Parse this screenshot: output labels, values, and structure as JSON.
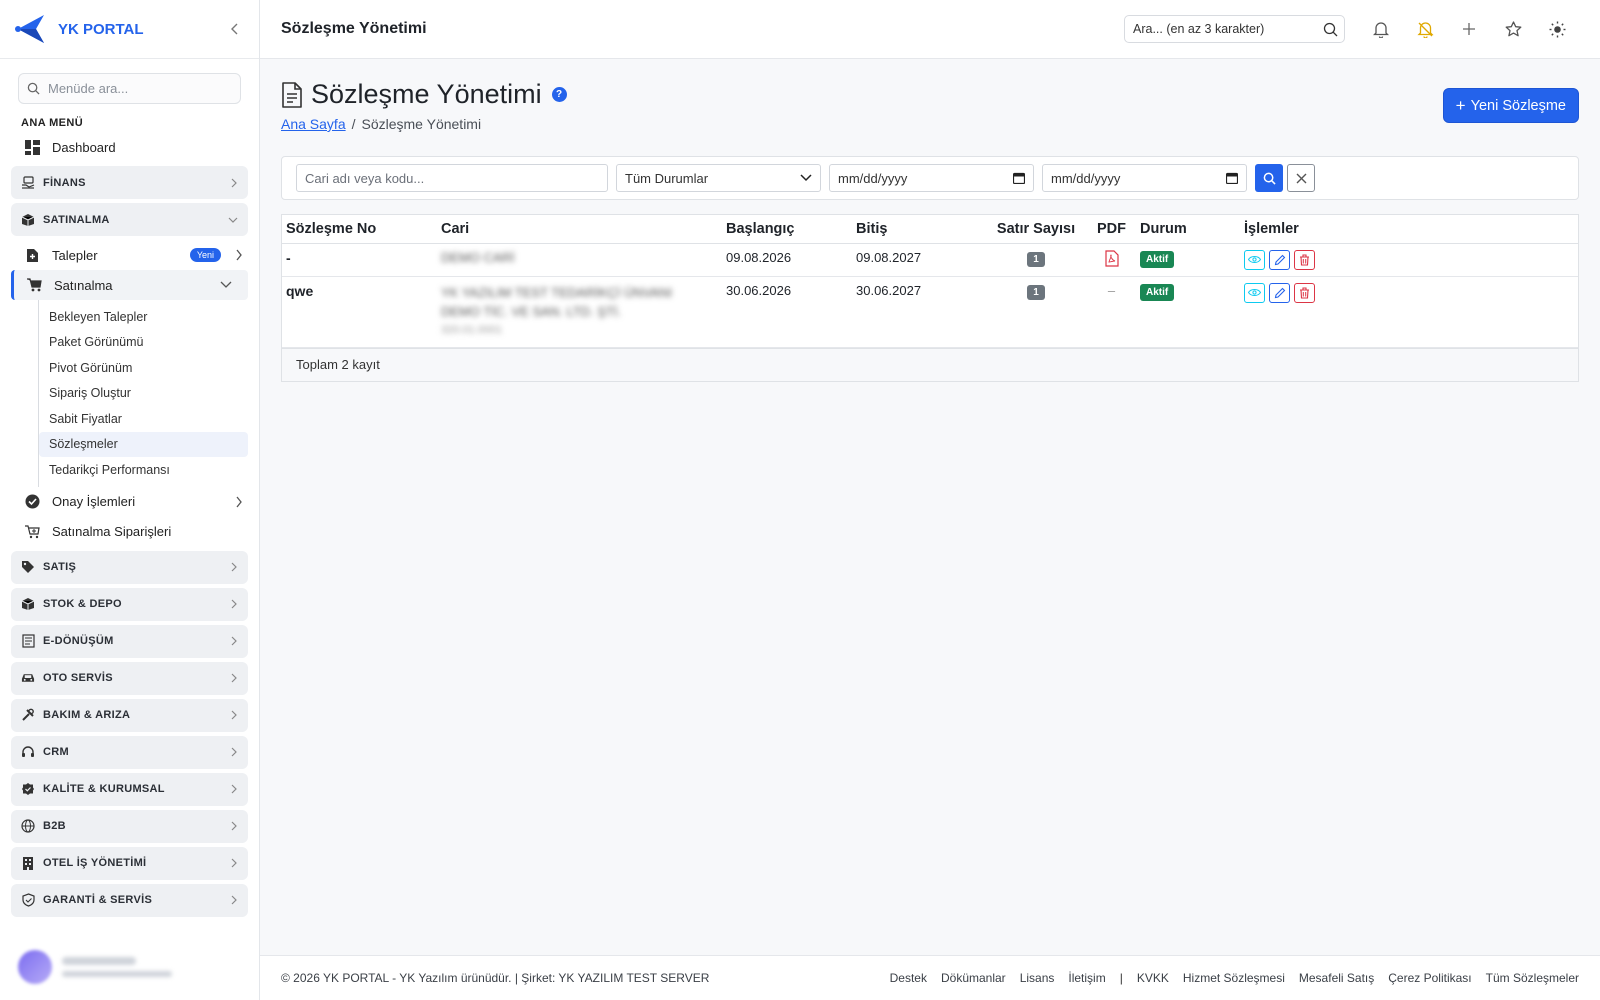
{
  "brand": {
    "name": "YK PORTAL"
  },
  "sidebar": {
    "search_placeholder": "Menüde ara...",
    "section_label": "ANA MENÜ",
    "dashboard": "Dashboard",
    "groups_top": [
      {
        "label": "FİNANS",
        "icon": "hand-money-icon"
      },
      {
        "label": "SATINALMA",
        "icon": "box-icon"
      }
    ],
    "satinalma": {
      "talepler": {
        "label": "Talepler",
        "badge": "Yeni"
      },
      "satinalma": {
        "label": "Satınalma"
      },
      "leaves": [
        "Bekleyen Talepler",
        "Paket Görünümü",
        "Pivot Görünüm",
        "Sipariş Oluştur",
        "Sabit Fiyatlar",
        "Sözleşmeler",
        "Tedarikçi Performansı"
      ],
      "active_leaf": "Sözleşmeler",
      "onay": {
        "label": "Onay İşlemleri"
      },
      "siparisler": {
        "label": "Satınalma Siparişleri"
      }
    },
    "groups_bottom": [
      {
        "label": "SATIŞ",
        "icon": "tag-icon"
      },
      {
        "label": "STOK & DEPO",
        "icon": "boxes-icon"
      },
      {
        "label": "E-DÖNÜŞÜM",
        "icon": "document-icon"
      },
      {
        "label": "OTO SERVİS",
        "icon": "car-icon"
      },
      {
        "label": "BAKIM & ARIZA",
        "icon": "tools-icon"
      },
      {
        "label": "CRM",
        "icon": "headset-icon"
      },
      {
        "label": "KALİTE & KURUMSAL",
        "icon": "award-icon"
      },
      {
        "label": "B2B",
        "icon": "globe-icon"
      },
      {
        "label": "OTEL İŞ YÖNETİMİ",
        "icon": "building-icon"
      },
      {
        "label": "GARANTİ & SERVİS",
        "icon": "shield-icon"
      }
    ]
  },
  "topbar": {
    "title": "Sözleşme Yönetimi",
    "search_placeholder": "Ara... (en az 3 karakter)"
  },
  "page": {
    "title": "Sözleşme Yönetimi",
    "help": "?",
    "breadcrumb_home": "Ana Sayfa",
    "breadcrumb_sep": "/",
    "breadcrumb_current": "Sözleşme Yönetimi",
    "new_button": "Yeni Sözleşme",
    "new_button_plus": "+"
  },
  "filters": {
    "cari_placeholder": "Cari adı veya kodu...",
    "status_value": "Tüm Durumlar",
    "date_start_placeholder": "mm/dd/yyyy",
    "date_end_placeholder": "mm/dd/yyyy"
  },
  "table": {
    "headers": [
      "Sözleşme No",
      "Cari",
      "Başlangıç",
      "Bitiş",
      "Satır Sayısı",
      "PDF",
      "Durum",
      "İşlemler"
    ],
    "rows": [
      {
        "no": "-",
        "cari": "DEMO CARİ",
        "cari2": "",
        "cari3": "",
        "start": "09.08.2026",
        "end": "09.08.2027",
        "lines": "1",
        "pdf": true,
        "pdf_text": "",
        "status": "Aktif"
      },
      {
        "no": "qwe",
        "cari": "YK YAZILIM TEST TEDARİKÇİ ÜNVANI",
        "cari2": "DEMO TİC. VE SAN. LTD. ŞTİ.",
        "cari3": "320.01.0001",
        "start": "30.06.2026",
        "end": "30.06.2027",
        "lines": "1",
        "pdf": false,
        "pdf_text": "–",
        "status": "Aktif"
      }
    ],
    "footer": "Toplam 2 kayıt"
  },
  "footer": {
    "copyright": "© 2026 YK PORTAL - YK Yazılım ürünüdür. | Şirket: YK YAZILIM TEST SERVER",
    "links1": [
      "Destek",
      "Dökümanlar",
      "Lisans",
      "İletişim"
    ],
    "divider": "|",
    "links2": [
      "KVKK",
      "Hizmet Sözleşmesi",
      "Mesafeli Satış",
      "Çerez Politikası",
      "Tüm Sözleşmeler"
    ]
  },
  "colors": {
    "accent": "#2463eb",
    "success": "#198754",
    "danger": "#dc3545",
    "info": "#0dcaf0"
  }
}
